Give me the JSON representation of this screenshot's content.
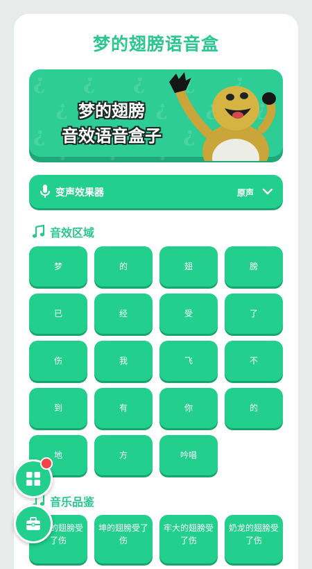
{
  "title": "梦的翅膀语音盒",
  "banner": {
    "line1": "梦的翅膀",
    "line2": "音效语音盒子",
    "pattern": "¿ ¿ ¿ ¿ ¿ ¿ ¿ ¿\n ¿ ¿ ¿ ¿ ¿ ¿ ¿\n¿ ¿ ¿ ¿ ¿ ¿ ¿ ¿\n ¿ ¿ ¿ ¿ ¿ ¿ ¿"
  },
  "effect_bar": {
    "label": "变声效果器",
    "value": "原声"
  },
  "sections": {
    "sound_effects": "音效区域",
    "music": "音乐品鉴"
  },
  "sound_buttons": [
    "梦",
    "的",
    "翅",
    "膀",
    "已",
    "经",
    "受",
    "了",
    "伤",
    "我",
    "飞",
    "不",
    "到",
    "有",
    "你",
    "的",
    "地",
    "方",
    "吟唱"
  ],
  "music_buttons": [
    "未来的翅膀受了伤",
    "坤的翅膀受了伤",
    "牢大的翅膀受了伤",
    "奶龙的翅膀受了伤"
  ],
  "colors": {
    "accent": "#22cf8c",
    "title": "#2bc78f",
    "badge": "#f04545"
  },
  "icons": {
    "grid": "grid-icon",
    "toolbox": "toolbox-icon",
    "mic": "microphone-icon",
    "note": "music-note-icon",
    "chevron": "chevron-down-icon"
  }
}
